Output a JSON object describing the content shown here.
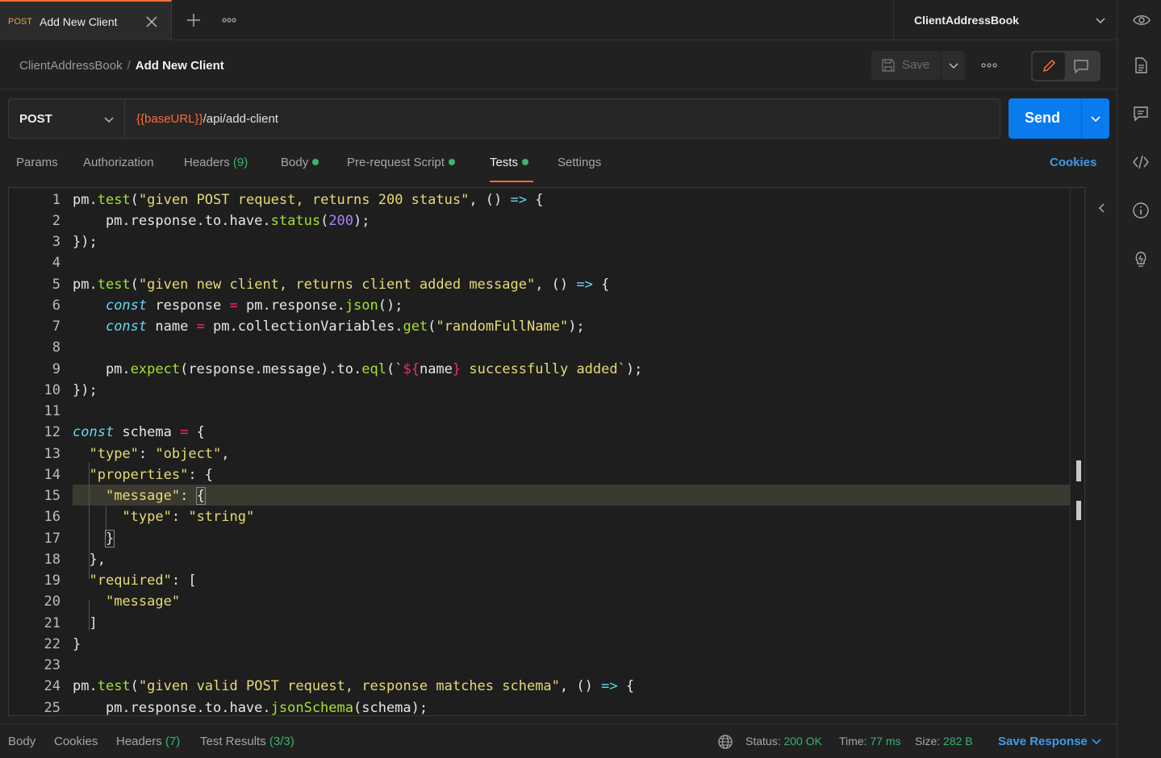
{
  "tab": {
    "method": "POST",
    "name": "Add New Client"
  },
  "environment": {
    "name": "ClientAddressBook"
  },
  "breadcrumb": {
    "parent": "ClientAddressBook",
    "separator": "/",
    "current": "Add New Client"
  },
  "toolbar": {
    "save_label": "Save"
  },
  "request": {
    "method": "POST",
    "url_var": "{{baseURL}}",
    "url_path": "/api/add-client",
    "send_label": "Send"
  },
  "subtabs": {
    "params": "Params",
    "authorization": "Authorization",
    "headers": "Headers",
    "headers_count": "(9)",
    "body": "Body",
    "prerequest": "Pre-request Script",
    "tests": "Tests",
    "settings": "Settings",
    "cookies": "Cookies"
  },
  "editor": {
    "line_numbers": [
      "1",
      "2",
      "3",
      "4",
      "5",
      "6",
      "7",
      "8",
      "9",
      "10",
      "11",
      "12",
      "13",
      "14",
      "15",
      "16",
      "17",
      "18",
      "19",
      "20",
      "21",
      "22",
      "23",
      "24",
      "25"
    ]
  },
  "response": {
    "body": "Body",
    "cookies": "Cookies",
    "headers": "Headers",
    "headers_count": "(7)",
    "test_results": "Test Results",
    "test_results_count": "(3/3)",
    "status_label": "Status:",
    "status_value": "200 OK",
    "time_label": "Time:",
    "time_value": "77 ms",
    "size_label": "Size:",
    "size_value": "282 B",
    "save_response": "Save Response"
  },
  "colors": {
    "accent": "#ff6c37",
    "send": "#097bed",
    "success": "#3cb371",
    "link": "#3d9be9"
  }
}
